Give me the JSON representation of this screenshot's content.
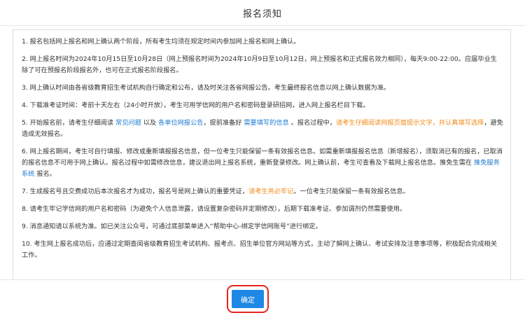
{
  "header": {
    "title": "报名须知"
  },
  "notices": [
    {
      "segments": [
        {
          "text": "1. 报名包括网上报名和网上确认两个阶段，所有考生均须在规定时间内参加网上报名和网上确认。",
          "style": "normal"
        }
      ]
    },
    {
      "segments": [
        {
          "text": "2. 网上报名时间为2024年10月15日至10月28日（网上预报名时间为2024年10月9日至10月12日，网上预报名和正式报名效力相同），每天9:00-22:00。应届毕业生除了可在预报名阶段报名外，也可在正式报名阶段报名。",
          "style": "normal"
        }
      ]
    },
    {
      "segments": [
        {
          "text": "3. 网上确认时间由各省级教育招生考试机构自行确定和公布，请及时关注各省网报公告。考生最终报名信息以网上确认数据为准。",
          "style": "normal"
        }
      ]
    },
    {
      "segments": [
        {
          "text": "4. 下载准考证时间：考前十天左右（24小时开放），考生可用学信网的用户名和密码登录研招网，进入网上报名栏目下载。",
          "style": "normal"
        }
      ]
    },
    {
      "segments": [
        {
          "text": "5. 开始报名前，请考生仔细阅读 ",
          "style": "normal"
        },
        {
          "text": "常见问题",
          "style": "blue"
        },
        {
          "text": " 以及 ",
          "style": "normal"
        },
        {
          "text": "各单位网报公告",
          "style": "blue"
        },
        {
          "text": "，提前准备好 ",
          "style": "normal"
        },
        {
          "text": "需要填写的信息",
          "style": "blue"
        },
        {
          "text": " 。报名过程中，",
          "style": "normal"
        },
        {
          "text": "请考生仔细阅读网报页面提示文字，并认真填写选择",
          "style": "orange"
        },
        {
          "text": "，避免造成无效报名。",
          "style": "normal"
        }
      ]
    },
    {
      "segments": [
        {
          "text": "6. 网上报名期间，考生可自行填报、修改或重新填报报名信息，但一位考生只能保留一条有效报名信息。如需重新填报报名信息（新增报名），须取消已有的报名，已取消的报名信息不可用于网上确认。报名过程中如需修改信息，建议退出网上报名系统，重新登录修改。网上确认前，考生可查看及下载网上报名信息。推免生需在 ",
          "style": "normal"
        },
        {
          "text": "推免服务系统",
          "style": "blue"
        },
        {
          "text": " 报名。",
          "style": "normal"
        }
      ]
    },
    {
      "segments": [
        {
          "text": "7. 生成报名号且交费成功后本次报名才为成功，报名号是网上确认的重要凭证，",
          "style": "normal"
        },
        {
          "text": "请考生务必牢记",
          "style": "orange"
        },
        {
          "text": "。一位考生只能保留一条有效报名信息。",
          "style": "normal"
        }
      ]
    },
    {
      "segments": [
        {
          "text": "8. 请考生牢记学信网的用户名和密码（为避免个人信息泄露，请设置复杂密码并定期修改），后期下载准考证、参加调剂仍然需要使用。",
          "style": "normal"
        }
      ]
    },
    {
      "segments": [
        {
          "text": "9. 消息通知请以系统为准。如已关注公众号，可通过底部菜单进入“帮助中心-绑定学信网账号”进行绑定。",
          "style": "normal"
        }
      ]
    },
    {
      "segments": [
        {
          "text": "10. 考生网上报名成功后，应通过定期查阅省级教育招生考试机构、报考点、招生单位官方网站等方式，主动了解网上确认、考试安排及注意事项等，积极配合完成相关工作。",
          "style": "normal"
        }
      ]
    }
  ],
  "footer": {
    "confirm_label": "确定"
  },
  "colors": {
    "link": "#1e7ad0",
    "warning": "#f08c1c",
    "button": "#1e88e5",
    "highlight_outline": "#e5251f"
  }
}
